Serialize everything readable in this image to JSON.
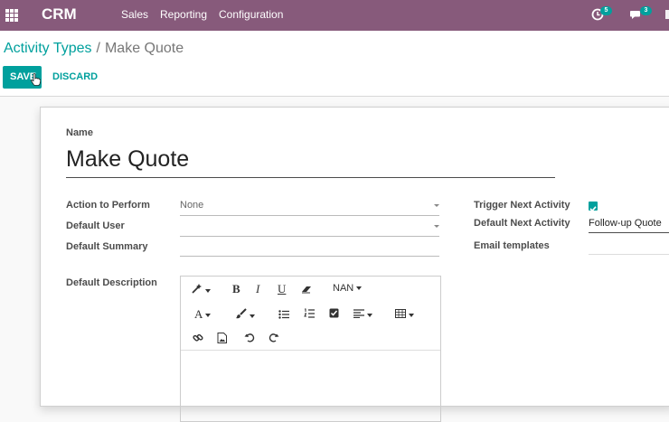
{
  "navbar": {
    "brand": "CRM",
    "menu": [
      "Sales",
      "Reporting",
      "Configuration"
    ],
    "activity_badge": "5",
    "messages_badge": "3"
  },
  "breadcrumb": {
    "parent": "Activity Types",
    "separator": "/",
    "current": "Make Quote"
  },
  "buttons": {
    "save": "SAVE",
    "discard": "DISCARD"
  },
  "form": {
    "name_label": "Name",
    "name_value": "Make Quote",
    "action_label": "Action to Perform",
    "action_value": "None",
    "default_user_label": "Default User",
    "default_user_value": "",
    "default_summary_label": "Default Summary",
    "default_summary_value": "",
    "default_description_label": "Default Description",
    "trigger_label": "Trigger Next Activity",
    "trigger_checked": true,
    "default_next_label": "Default Next Activity",
    "default_next_value": "Follow-up Quote",
    "email_templates_label": "Email templates"
  },
  "editor_toolbar": {
    "bold": "B",
    "italic": "I",
    "underline": "U",
    "font_size": "NAN",
    "font_color": "A"
  },
  "colors": {
    "navbar": "#875a7b",
    "accent": "#00a09d"
  }
}
